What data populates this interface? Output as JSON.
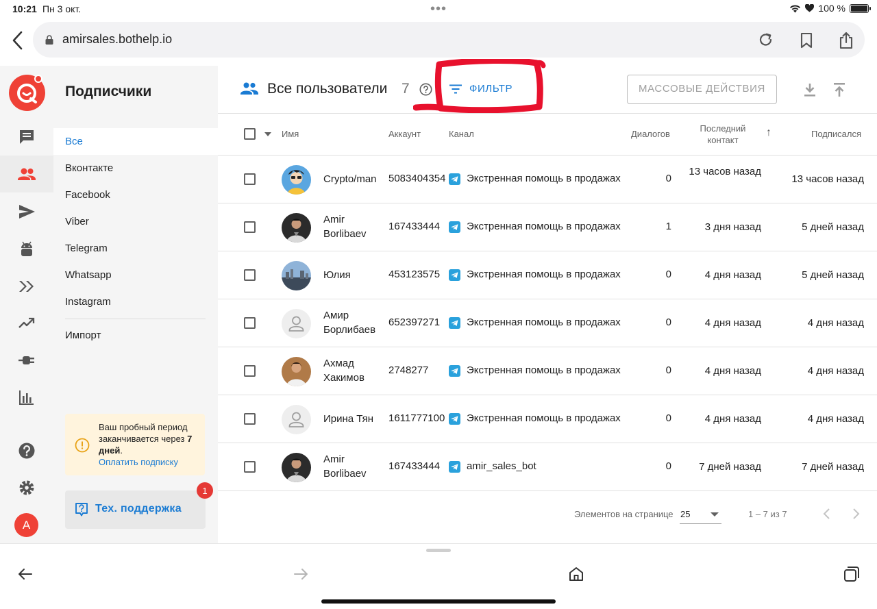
{
  "status_bar": {
    "time": "10:21",
    "date": "Пн 3 окт.",
    "battery": "100 %"
  },
  "browser": {
    "url": "amirsales.bothelp.io"
  },
  "rail": {
    "avatar_letter": "A"
  },
  "subnav": {
    "title": "Подписчики",
    "items": [
      {
        "label": "Все",
        "active": true
      },
      {
        "label": "Вконтакте"
      },
      {
        "label": "Facebook"
      },
      {
        "label": "Viber"
      },
      {
        "label": "Telegram"
      },
      {
        "label": "Whatsapp"
      },
      {
        "label": "Instagram"
      },
      {
        "label": "Импорт"
      }
    ],
    "trial": {
      "line1": "Ваш пробный период заканчивается через",
      "days": "7 дней",
      "dot": ".",
      "link": "Оплатить подписку"
    },
    "support": {
      "label": "Тех. поддержка",
      "badge": "1"
    }
  },
  "header": {
    "title": "Все пользователи",
    "count": "7",
    "filter_label": "ФИЛЬТР",
    "mass_actions_label": "МАССОВЫЕ ДЕЙСТВИЯ"
  },
  "table": {
    "columns": {
      "name": "Имя",
      "account": "Аккаунт",
      "channel": "Канал",
      "dialogs": "Диалогов",
      "last_contact_1": "Последний",
      "last_contact_2": "контакт",
      "sort_indicator": "↑",
      "subscribed": "Подписался"
    },
    "rows": [
      {
        "name": "Crypto/man",
        "account": "5083404354",
        "channel": "Экстренная помощь в продажах",
        "dialogs": "0",
        "last": "13 часов назад",
        "subscribed": "13 часов назад",
        "avatar": "cartoon"
      },
      {
        "name": "Amir Borlibaev",
        "account": "167433444",
        "channel": "Экстренная помощь в продажах",
        "dialogs": "1",
        "last": "3 дня назад",
        "subscribed": "5 дней назад",
        "avatar": "photo-dark"
      },
      {
        "name": "Юлия",
        "account": "453123575",
        "channel": "Экстренная помощь в продажах",
        "dialogs": "0",
        "last": "4 дня назад",
        "subscribed": "5 дней назад",
        "avatar": "photo-city"
      },
      {
        "name": "Амир Борлибаев",
        "account": "652397271",
        "channel": "Экстренная помощь в продажах",
        "dialogs": "0",
        "last": "4 дня назад",
        "subscribed": "4 дня назад",
        "avatar": "placeholder"
      },
      {
        "name": "Ахмад Хакимов",
        "account": "2748277",
        "channel": "Экстренная помощь в продажах",
        "dialogs": "0",
        "last": "4 дня назад",
        "subscribed": "4 дня назад",
        "avatar": "photo-warm"
      },
      {
        "name": "Ирина Тян",
        "account": "1611777100",
        "channel": "Экстренная помощь в продажах",
        "dialogs": "0",
        "last": "4 дня назад",
        "subscribed": "4 дня назад",
        "avatar": "placeholder"
      },
      {
        "name": "Amir Borlibaev",
        "account": "167433444",
        "channel": "amir_sales_bot",
        "dialogs": "0",
        "last": "7 дней назад",
        "subscribed": "7 дней назад",
        "avatar": "photo-dark"
      }
    ]
  },
  "pagination": {
    "per_page_label": "Элементов на странице",
    "per_page_value": "25",
    "range": "1 – 7 из 7"
  },
  "colors": {
    "accent": "#1a7bd3",
    "brand": "#ef4136",
    "telegram": "#2aa1dc",
    "annotation": "#e8112d",
    "trial_bg": "#fff4dd"
  },
  "icons": [
    "back-chevron-icon",
    "lock-icon",
    "reload-icon",
    "bookmark-icon",
    "share-icon",
    "chat-icon",
    "users-icon",
    "send-icon",
    "android-icon",
    "chevrons-icon",
    "trending-icon",
    "plug-icon",
    "bar-chart-icon",
    "help-icon",
    "gear-icon",
    "filter-icon",
    "download-icon",
    "upload-icon",
    "telegram-icon",
    "info-icon",
    "support-icon",
    "tabs-icon",
    "home-icon"
  ]
}
